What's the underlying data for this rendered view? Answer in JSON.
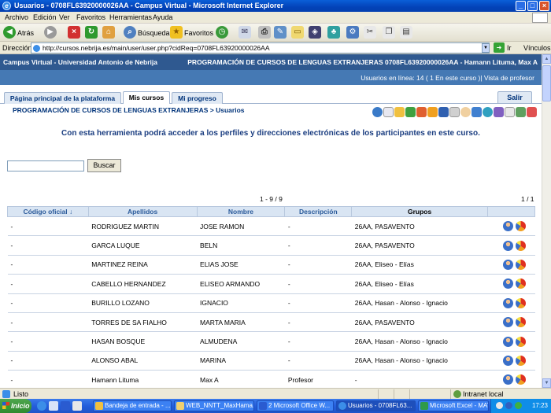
{
  "window": {
    "title": "Usuarios - 0708FL63920000026AA - Campus Virtual - Microsoft Internet Explorer",
    "buttons": [
      "_",
      "□",
      "×"
    ]
  },
  "menu": [
    "Archivo",
    "Edición",
    "Ver",
    "Favoritos",
    "Herramientas",
    "Ayuda"
  ],
  "toolbar": {
    "back_label": "Atrás",
    "search_label": "Búsqueda",
    "favorites_label": "Favoritos"
  },
  "address": {
    "label": "Dirección",
    "url": "http://cursos.nebrija.es/main/user/user.php?cidReq=0708FL63920000026AA",
    "go_label": "Ir",
    "links_label": "Vínculos"
  },
  "campus": {
    "left": "Campus Virtual - Universidad Antonio de Nebrija",
    "right": "PROGRAMACIÓN DE CURSOS DE LENGUAS EXTRANJERAS 0708FL63920000026AA - Hamann Lituma, Max A",
    "online": "Usuarios en línea:  14  ( 1 En este curso )| Vista de profesor"
  },
  "tabs": [
    {
      "label": "Página principal de la plataforma"
    },
    {
      "label": "Mis cursos"
    },
    {
      "label": "Mi progreso"
    }
  ],
  "salir_label": "Salir",
  "breadcrumb": {
    "course": "PROGRAMACIÓN DE CURSOS DE LENGUAS EXTRANJERAS",
    "sep": " > ",
    "page": "Usuarios"
  },
  "intro": "Con esta herramienta podrá acceder a los perfiles y direcciones electrónicas de los participantes en este curso.",
  "search": {
    "value": "",
    "button_label": "Buscar"
  },
  "pager": {
    "range": "1 - 9 / 9",
    "pages": "1 / 1"
  },
  "table": {
    "headers": [
      "Código oficial ↓",
      "Apellidos",
      "Nombre",
      "Descripción",
      "Grupos",
      ""
    ],
    "rows": [
      [
        "-",
        "RODRIGUEZ MARTIN",
        "JOSE RAMON",
        "-",
        "26AA, PASAVENTO"
      ],
      [
        "-",
        "GARCA LUQUE",
        "BELN",
        "-",
        "26AA, PASAVENTO"
      ],
      [
        "-",
        "MARTINEZ REINA",
        "ELIAS JOSE",
        "-",
        "26AA, Eliseo - Elías"
      ],
      [
        "-",
        "CABELLO HERNANDEZ",
        "ELISEO ARMANDO",
        "-",
        "26AA, Eliseo - Elías"
      ],
      [
        "-",
        "BURILLO LOZANO",
        "IGNACIO",
        "-",
        "26AA, Hasan - Alonso - Ignacio"
      ],
      [
        "-",
        "TORRES DE SA FIALHO",
        "MARTA MARIA",
        "-",
        "26AA, PASAVENTO"
      ],
      [
        "-",
        "HASAN BOSQUE",
        "ALMUDENA",
        "-",
        "26AA, Hasan - Alonso - Ignacio"
      ],
      [
        "-",
        "ALONSO ABAL",
        "MARINA",
        "-",
        "26AA, Hasan - Alonso - Ignacio"
      ],
      [
        "-",
        "Hamann Lituma",
        "Max A",
        "Profesor",
        "-"
      ]
    ]
  },
  "status": {
    "text": "Listo",
    "zone": "Intranet local"
  },
  "taskbar": {
    "start": "Inicio",
    "tasks": [
      "Bandeja de entrada - ...",
      "WEB_NNTT_MaxHama...",
      "2 Microsoft Office W...",
      "Usuarios - 0708FL63...",
      "Microsoft Excel - MAT..."
    ],
    "clock": "17:23"
  }
}
